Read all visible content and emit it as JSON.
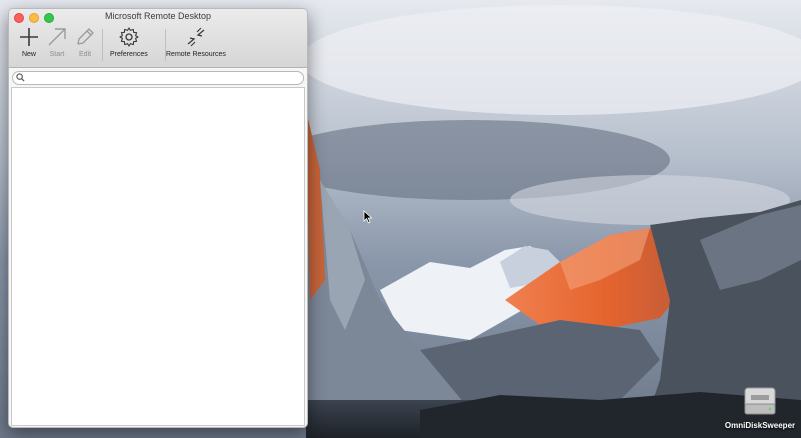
{
  "window": {
    "title": "Microsoft Remote Desktop"
  },
  "toolbar": {
    "new_label": "New",
    "start_label": "Start",
    "edit_label": "Edit",
    "preferences_label": "Preferences",
    "remote_resources_label": "Remote Resources"
  },
  "search": {
    "value": "",
    "placeholder": ""
  },
  "desktop": {
    "drive_label": "OmniDiskSweeper"
  },
  "colors": {
    "close": "#fc605c",
    "minimize": "#fdbc40",
    "maximize": "#34c84a"
  },
  "icons": {
    "new": "plus-icon",
    "start": "arrow-icon",
    "edit": "pencil-icon",
    "preferences": "gear-icon",
    "remote_resources": "remote-resources-icon",
    "search": "magnifier-icon",
    "drive": "drive-icon"
  }
}
